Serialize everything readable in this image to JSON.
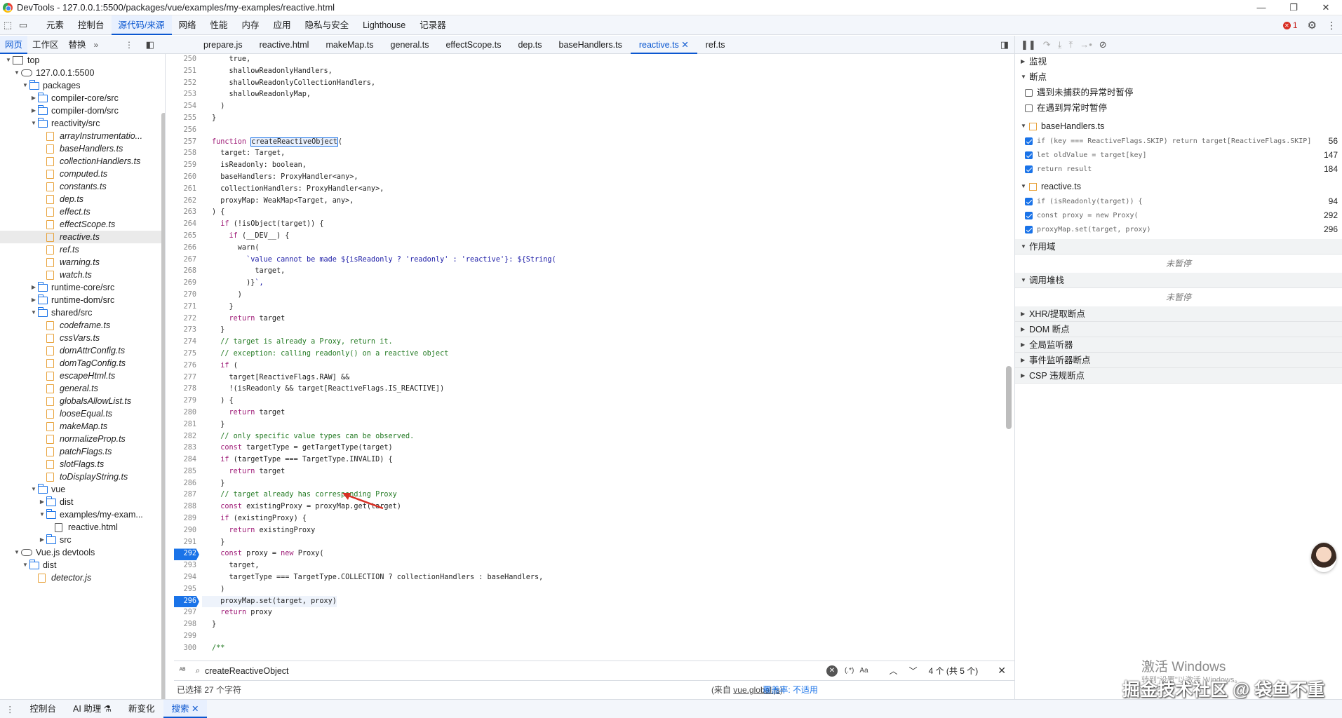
{
  "window": {
    "title": "DevTools - 127.0.0.1:5500/packages/vue/examples/my-examples/reactive.html"
  },
  "main_tabs": [
    "元素",
    "控制台",
    "源代码/来源",
    "网络",
    "性能",
    "内存",
    "应用",
    "隐私与安全",
    "Lighthouse",
    "记录器"
  ],
  "active_main_tab": "源代码/来源",
  "error_count": "1",
  "nav_tabs": [
    "网页",
    "工作区",
    "替换"
  ],
  "file_tabs": [
    "prepare.js",
    "reactive.html",
    "makeMap.ts",
    "general.ts",
    "effectScope.ts",
    "dep.ts",
    "baseHandlers.ts",
    "reactive.ts",
    "ref.ts"
  ],
  "active_file_tab": "reactive.ts",
  "tree": [
    {
      "label": "top",
      "depth": 0,
      "kind": "frame",
      "arrow": "open"
    },
    {
      "label": "127.0.0.1:5500",
      "depth": 1,
      "kind": "cloud",
      "arrow": "open"
    },
    {
      "label": "packages",
      "depth": 2,
      "kind": "folder",
      "arrow": "open"
    },
    {
      "label": "compiler-core/src",
      "depth": 3,
      "kind": "folder",
      "arrow": "closed"
    },
    {
      "label": "compiler-dom/src",
      "depth": 3,
      "kind": "folder",
      "arrow": "closed"
    },
    {
      "label": "reactivity/src",
      "depth": 3,
      "kind": "folder",
      "arrow": "open"
    },
    {
      "label": "arrayInstrumentatio...",
      "depth": 4,
      "kind": "file"
    },
    {
      "label": "baseHandlers.ts",
      "depth": 4,
      "kind": "file"
    },
    {
      "label": "collectionHandlers.ts",
      "depth": 4,
      "kind": "file"
    },
    {
      "label": "computed.ts",
      "depth": 4,
      "kind": "file"
    },
    {
      "label": "constants.ts",
      "depth": 4,
      "kind": "file"
    },
    {
      "label": "dep.ts",
      "depth": 4,
      "kind": "file"
    },
    {
      "label": "effect.ts",
      "depth": 4,
      "kind": "file"
    },
    {
      "label": "effectScope.ts",
      "depth": 4,
      "kind": "file"
    },
    {
      "label": "reactive.ts",
      "depth": 4,
      "kind": "file",
      "selected": true
    },
    {
      "label": "ref.ts",
      "depth": 4,
      "kind": "file"
    },
    {
      "label": "warning.ts",
      "depth": 4,
      "kind": "file"
    },
    {
      "label": "watch.ts",
      "depth": 4,
      "kind": "file"
    },
    {
      "label": "runtime-core/src",
      "depth": 3,
      "kind": "folder",
      "arrow": "closed"
    },
    {
      "label": "runtime-dom/src",
      "depth": 3,
      "kind": "folder",
      "arrow": "closed"
    },
    {
      "label": "shared/src",
      "depth": 3,
      "kind": "folder",
      "arrow": "open"
    },
    {
      "label": "codeframe.ts",
      "depth": 4,
      "kind": "file"
    },
    {
      "label": "cssVars.ts",
      "depth": 4,
      "kind": "file"
    },
    {
      "label": "domAttrConfig.ts",
      "depth": 4,
      "kind": "file"
    },
    {
      "label": "domTagConfig.ts",
      "depth": 4,
      "kind": "file"
    },
    {
      "label": "escapeHtml.ts",
      "depth": 4,
      "kind": "file"
    },
    {
      "label": "general.ts",
      "depth": 4,
      "kind": "file"
    },
    {
      "label": "globalsAllowList.ts",
      "depth": 4,
      "kind": "file"
    },
    {
      "label": "looseEqual.ts",
      "depth": 4,
      "kind": "file"
    },
    {
      "label": "makeMap.ts",
      "depth": 4,
      "kind": "file"
    },
    {
      "label": "normalizeProp.ts",
      "depth": 4,
      "kind": "file"
    },
    {
      "label": "patchFlags.ts",
      "depth": 4,
      "kind": "file"
    },
    {
      "label": "slotFlags.ts",
      "depth": 4,
      "kind": "file"
    },
    {
      "label": "toDisplayString.ts",
      "depth": 4,
      "kind": "file"
    },
    {
      "label": "vue",
      "depth": 3,
      "kind": "folder",
      "arrow": "open"
    },
    {
      "label": "dist",
      "depth": 4,
      "kind": "folder",
      "arrow": "closed"
    },
    {
      "label": "examples/my-exam...",
      "depth": 4,
      "kind": "folder",
      "arrow": "open"
    },
    {
      "label": "reactive.html",
      "depth": 5,
      "kind": "html"
    },
    {
      "label": "src",
      "depth": 4,
      "kind": "folder",
      "arrow": "closed"
    },
    {
      "label": "Vue.js devtools",
      "depth": 1,
      "kind": "cloud",
      "arrow": "open"
    },
    {
      "label": "dist",
      "depth": 2,
      "kind": "folder",
      "arrow": "open"
    },
    {
      "label": "detector.js",
      "depth": 3,
      "kind": "file"
    }
  ],
  "code_lines": [
    {
      "n": "250",
      "t": "    true,"
    },
    {
      "n": "251",
      "t": "    shallowReadonlyHandlers,"
    },
    {
      "n": "252",
      "t": "    shallowReadonlyCollectionHandlers,"
    },
    {
      "n": "253",
      "t": "    shallowReadonlyMap,"
    },
    {
      "n": "254",
      "t": "  )"
    },
    {
      "n": "255",
      "t": "}"
    },
    {
      "n": "256",
      "t": ""
    },
    {
      "n": "257",
      "t": "function createReactiveObject("
    },
    {
      "n": "258",
      "t": "  target: Target,"
    },
    {
      "n": "259",
      "t": "  isReadonly: boolean,"
    },
    {
      "n": "260",
      "t": "  baseHandlers: ProxyHandler<any>,"
    },
    {
      "n": "261",
      "t": "  collectionHandlers: ProxyHandler<any>,"
    },
    {
      "n": "262",
      "t": "  proxyMap: WeakMap<Target, any>,"
    },
    {
      "n": "263",
      "t": ") {"
    },
    {
      "n": "264",
      "t": "  if (!isObject(target)) {"
    },
    {
      "n": "265",
      "t": "    if (__DEV__) {"
    },
    {
      "n": "266",
      "t": "      warn("
    },
    {
      "n": "267",
      "t": "        `value cannot be made ${isReadonly ? 'readonly' : 'reactive'}: ${String("
    },
    {
      "n": "268",
      "t": "          target,"
    },
    {
      "n": "269",
      "t": "        )}`,"
    },
    {
      "n": "270",
      "t": "      )"
    },
    {
      "n": "271",
      "t": "    }"
    },
    {
      "n": "272",
      "t": "    return target"
    },
    {
      "n": "273",
      "t": "  }"
    },
    {
      "n": "274",
      "t": "  // target is already a Proxy, return it."
    },
    {
      "n": "275",
      "t": "  // exception: calling readonly() on a reactive object"
    },
    {
      "n": "276",
      "t": "  if ("
    },
    {
      "n": "277",
      "t": "    target[ReactiveFlags.RAW] &&"
    },
    {
      "n": "278",
      "t": "    !(isReadonly && target[ReactiveFlags.IS_REACTIVE])"
    },
    {
      "n": "279",
      "t": "  ) {"
    },
    {
      "n": "280",
      "t": "    return target"
    },
    {
      "n": "281",
      "t": "  }"
    },
    {
      "n": "282",
      "t": "  // only specific value types can be observed."
    },
    {
      "n": "283",
      "t": "  const targetType = getTargetType(target)"
    },
    {
      "n": "284",
      "t": "  if (targetType === TargetType.INVALID) {"
    },
    {
      "n": "285",
      "t": "    return target"
    },
    {
      "n": "286",
      "t": "  }"
    },
    {
      "n": "287",
      "t": "  // target already has corresponding Proxy"
    },
    {
      "n": "288",
      "t": "  const existingProxy = proxyMap.get(target)"
    },
    {
      "n": "289",
      "t": "  if (existingProxy) {"
    },
    {
      "n": "290",
      "t": "    return existingProxy"
    },
    {
      "n": "291",
      "t": "  }"
    },
    {
      "n": "292",
      "t": "  const proxy = new Proxy(",
      "bp": true
    },
    {
      "n": "293",
      "t": "    target,"
    },
    {
      "n": "294",
      "t": "    targetType === TargetType.COLLECTION ? collectionHandlers : baseHandlers,"
    },
    {
      "n": "295",
      "t": "  )"
    },
    {
      "n": "296",
      "t": "  proxyMap.set(target, proxy)",
      "bp": true
    },
    {
      "n": "297",
      "t": "  return proxy"
    },
    {
      "n": "298",
      "t": "}"
    },
    {
      "n": "299",
      "t": ""
    },
    {
      "n": "300",
      "t": "/**"
    }
  ],
  "search": {
    "query": "createReactiveObject",
    "match_info": "4 个 (共 5 个)",
    "regex": "(.*)",
    "case": "Aa"
  },
  "status": {
    "selection": "已选择 27 个字符",
    "source_prefix": "(来自 ",
    "source_link": "vue.global.js",
    "source_suffix": ")",
    "coverage": "覆盖率: 不适用"
  },
  "debugger": {
    "watch": "监视",
    "breakpoints": "断点",
    "pause_uncaught": "遇到未捕获的异常时暂停",
    "pause_caught": "在遇到异常时暂停",
    "bp_groups": [
      {
        "file": "baseHandlers.ts",
        "items": [
          {
            "code": "if (key === ReactiveFlags.SKIP) return target[ReactiveFlags.SKIP]",
            "line": "56"
          },
          {
            "code": "let oldValue = target[key]",
            "line": "147"
          },
          {
            "code": "return result",
            "line": "184"
          }
        ]
      },
      {
        "file": "reactive.ts",
        "items": [
          {
            "code": "if (isReadonly(target)) {",
            "line": "94"
          },
          {
            "code": "const proxy = new Proxy(",
            "line": "292"
          },
          {
            "code": "proxyMap.set(target, proxy)",
            "line": "296"
          }
        ]
      }
    ],
    "scope": "作用域",
    "not_paused": "未暂停",
    "call_stack": "调用堆栈",
    "not_paused2": "未暂停",
    "xhr": "XHR/提取断点",
    "dom": "DOM 断点",
    "global": "全局监听器",
    "event": "事件监听器断点",
    "csp": "CSP 违规断点"
  },
  "drawer_tabs": [
    "控制台",
    "AI 助理",
    "新变化",
    "搜索"
  ],
  "active_drawer_tab": "搜索",
  "watermark": {
    "line1": "激活 Windows",
    "line2": "转到\"设置\"以激活 Windows。"
  },
  "brand": "掘金技术社区 @ 袋鱼不重",
  "colors": {
    "accent": "#1a73e8",
    "keyword": "#9e1a76",
    "comment": "#237a23",
    "string": "#1a1aa6",
    "arrow": "#d93025"
  }
}
